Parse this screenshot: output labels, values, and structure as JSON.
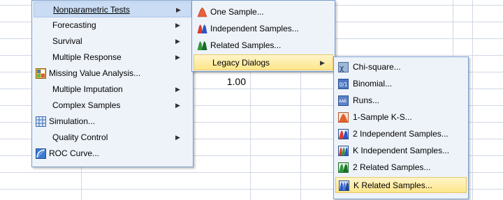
{
  "spreadsheet": {
    "cell_value": "1.00"
  },
  "menu_main": {
    "items": [
      {
        "label": "Nonparametric Tests",
        "submenu": true
      },
      {
        "label": "Forecasting",
        "submenu": true
      },
      {
        "label": "Survival",
        "submenu": true
      },
      {
        "label": "Multiple Response",
        "submenu": true
      },
      {
        "label": "Missing Value Analysis...",
        "icon": "missing-value-icon"
      },
      {
        "label": "Multiple Imputation",
        "submenu": true
      },
      {
        "label": "Complex Samples",
        "submenu": true
      },
      {
        "label": "Simulation...",
        "icon": "simulation-icon"
      },
      {
        "label": "Quality Control",
        "submenu": true
      },
      {
        "label": "ROC Curve...",
        "icon": "roc-curve-icon"
      }
    ]
  },
  "menu_nonparametric": {
    "items": [
      {
        "label": "One Sample...",
        "icon": "one-sample-icon"
      },
      {
        "label": "Independent Samples...",
        "icon": "independent-samples-icon"
      },
      {
        "label": "Related Samples...",
        "icon": "related-samples-icon"
      },
      {
        "label": "Legacy Dialogs",
        "submenu": true
      }
    ]
  },
  "menu_legacy": {
    "items": [
      {
        "label": "Chi-square...",
        "icon": "chi-square-icon"
      },
      {
        "label": "Binomial...",
        "icon": "binomial-icon"
      },
      {
        "label": "Runs...",
        "icon": "runs-icon"
      },
      {
        "label": "1-Sample K-S...",
        "icon": "one-sample-ks-icon"
      },
      {
        "label": "2 Independent Samples...",
        "icon": "two-independent-samples-icon"
      },
      {
        "label": "K Independent Samples...",
        "icon": "k-independent-samples-icon"
      },
      {
        "label": "2 Related Samples...",
        "icon": "two-related-samples-icon"
      },
      {
        "label": "K Related Samples...",
        "icon": "k-related-samples-icon"
      }
    ]
  },
  "colors": {
    "menu_bg": "#eef3fa",
    "menu_border": "#7a9ecb",
    "highlight_blue": "#c9dcf3",
    "highlight_gold": "#fde68a"
  }
}
